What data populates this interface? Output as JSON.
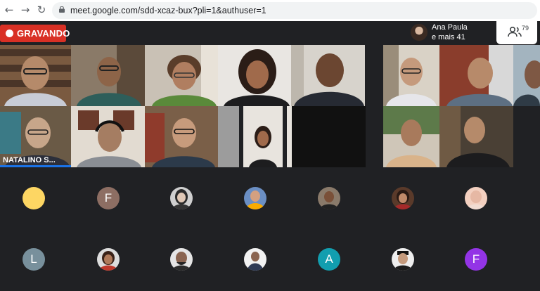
{
  "browser": {
    "back_icon": "arrow-left-icon",
    "forward_icon": "arrow-right-icon",
    "reload_icon": "reload-icon",
    "url": "meet.google.com/sdd-xcaz-bux?pli=1&authuser=1"
  },
  "recording": {
    "label": "GRAVANDO",
    "color": "#d93025"
  },
  "presenter": {
    "name": "Ana Paula",
    "more": "e mais 41"
  },
  "participants_button": {
    "count": "79",
    "icon": "people-icon"
  },
  "video_tiles": [
    {
      "name": ""
    },
    {
      "name": ""
    },
    {
      "name": ""
    },
    {
      "name": ""
    },
    {
      "name": ""
    },
    {
      "name": ""
    },
    {
      "name": ""
    },
    {
      "name": ""
    },
    {
      "name": "NATALINO S..."
    }
  ],
  "avatars": [
    {
      "letter": "",
      "color": "#fdd663"
    },
    {
      "letter": "F",
      "color": "#8d6e63"
    },
    {
      "letter": "",
      "color": "#3c4043"
    },
    {
      "letter": "",
      "color": "#f9ab00"
    },
    {
      "letter": "",
      "color": "#5f4b3b"
    },
    {
      "letter": "",
      "color": "#6b3a2e"
    },
    {
      "letter": "",
      "color": "#f6c9b8"
    },
    {
      "letter": "L",
      "color": "#78909c"
    },
    {
      "letter": "",
      "color": "#a0522d"
    },
    {
      "letter": "",
      "color": "#4e342e"
    },
    {
      "letter": "",
      "color": "#e8e8e8"
    },
    {
      "letter": "A",
      "color": "#129eaf"
    },
    {
      "letter": "",
      "color": "#3c4043"
    },
    {
      "letter": "F",
      "color": "#9334e6"
    }
  ]
}
